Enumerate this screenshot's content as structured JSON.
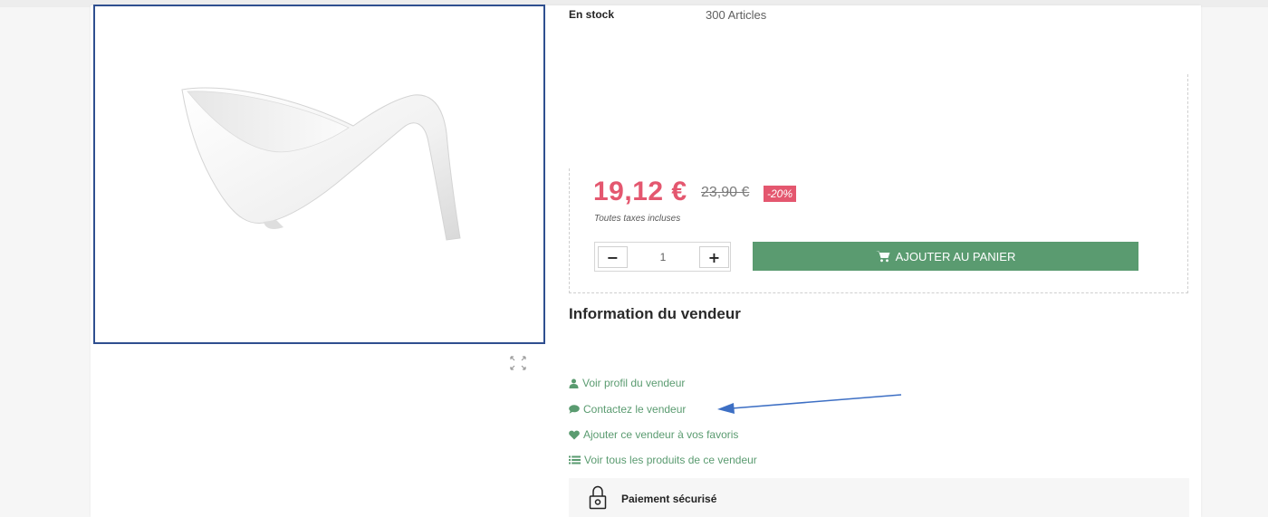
{
  "stock": {
    "label": "En stock",
    "value": "300 Articles"
  },
  "price": {
    "current": "19,12 €",
    "old": "23,90 €",
    "discount": "-20%",
    "tax_note": "Toutes taxes incluses"
  },
  "quantity": {
    "value": "1",
    "minus": "−",
    "plus": "+"
  },
  "cart": {
    "label": "AJOUTER AU PANIER"
  },
  "seller": {
    "title": "Information du vendeur",
    "links": [
      {
        "label": "Voir profil du vendeur",
        "icon": "user-icon"
      },
      {
        "label": "Contactez le vendeur",
        "icon": "chat-bubble-icon"
      },
      {
        "label": "Ajouter ce vendeur à vos favoris",
        "icon": "heart-icon"
      },
      {
        "label": "Voir tous les produits de ce vendeur",
        "icon": "list-icon"
      }
    ]
  },
  "secure": {
    "label": "Paiement sécurisé",
    "icon": "padlock-icon"
  },
  "colors": {
    "accent_green": "#5a9b70",
    "price_pink": "#e4576f",
    "frame_blue": "#2f4f8f",
    "annotation_arrow": "#3d6fc4"
  },
  "product_image": {
    "icon": "serving-bowl-image"
  },
  "expand": {
    "icon": "expand-icon"
  }
}
